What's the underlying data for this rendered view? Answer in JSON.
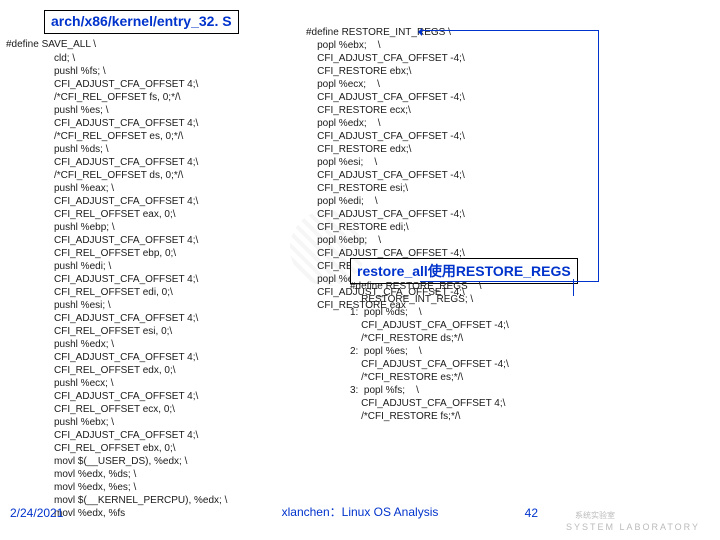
{
  "titles": {
    "left": "arch/x86/kernel/entry_32. S",
    "right": "restore_all使用RESTORE_REGS"
  },
  "code": {
    "left_top": "#define SAVE_ALL \\",
    "left": "cld; \\\npushl %fs; \\\nCFI_ADJUST_CFA_OFFSET 4;\\\n/*CFI_REL_OFFSET fs, 0;*/\\\npushl %es; \\\nCFI_ADJUST_CFA_OFFSET 4;\\\n/*CFI_REL_OFFSET es, 0;*/\\\npushl %ds; \\\nCFI_ADJUST_CFA_OFFSET 4;\\\n/*CFI_REL_OFFSET ds, 0;*/\\\npushl %eax; \\\nCFI_ADJUST_CFA_OFFSET 4;\\\nCFI_REL_OFFSET eax, 0;\\\npushl %ebp; \\\nCFI_ADJUST_CFA_OFFSET 4;\\\nCFI_REL_OFFSET ebp, 0;\\\npushl %edi; \\\nCFI_ADJUST_CFA_OFFSET 4;\\\nCFI_REL_OFFSET edi, 0;\\\npushl %esi; \\\nCFI_ADJUST_CFA_OFFSET 4;\\\nCFI_REL_OFFSET esi, 0;\\\npushl %edx; \\\nCFI_ADJUST_CFA_OFFSET 4;\\\nCFI_REL_OFFSET edx, 0;\\\npushl %ecx; \\\nCFI_ADJUST_CFA_OFFSET 4;\\\nCFI_REL_OFFSET ecx, 0;\\\npushl %ebx; \\\nCFI_ADJUST_CFA_OFFSET 4;\\\nCFI_REL_OFFSET ebx, 0;\\\nmovl $(__USER_DS), %edx; \\\nmovl %edx, %ds; \\\nmovl %edx, %es; \\\nmovl $(__KERNEL_PERCPU), %edx; \\\nmovl %edx, %fs",
    "right_top": "#define RESTORE_INT_REGS \\\n    popl %ebx;    \\\n    CFI_ADJUST_CFA_OFFSET -4;\\\n    CFI_RESTORE ebx;\\\n    popl %ecx;    \\\n    CFI_ADJUST_CFA_OFFSET -4;\\\n    CFI_RESTORE ecx;\\\n    popl %edx;    \\\n    CFI_ADJUST_CFA_OFFSET -4;\\\n    CFI_RESTORE edx;\\\n    popl %esi;    \\\n    CFI_ADJUST_CFA_OFFSET -4;\\\n    CFI_RESTORE esi;\\\n    popl %edi;    \\\n    CFI_ADJUST_CFA_OFFSET -4;\\\n    CFI_RESTORE edi;\\\n    popl %ebp;    \\\n    CFI_ADJUST_CFA_OFFSET -4;\\\n    CFI_RESTORE ebp;\\\n    popl %eax;    \\\n    CFI_ADJUST_CFA_OFFSET -4;\\\n    CFI_RESTORE eax",
    "right_bottom": "#define RESTORE_REGS    \\\n    RESTORE_INT_REGS; \\\n1:  popl %ds;    \\\n    CFI_ADJUST_CFA_OFFSET -4;\\\n    /*CFI_RESTORE ds;*/\\\n2:  popl %es;    \\\n    CFI_ADJUST_CFA_OFFSET -4;\\\n    /*CFI_RESTORE es;*/\\\n3:  popl %fs;    \\\n    CFI_ADJUST_CFA_OFFSET 4;\\\n    /*CFI_RESTORE fs;*/\\"
  },
  "footer": {
    "date": "2/24/2021",
    "center": "xlanchen：Linux OS Analysis",
    "page": "42"
  },
  "watermark": {
    "lab": "系统实验室",
    "sub": "SYSTEM LABORATORY"
  }
}
